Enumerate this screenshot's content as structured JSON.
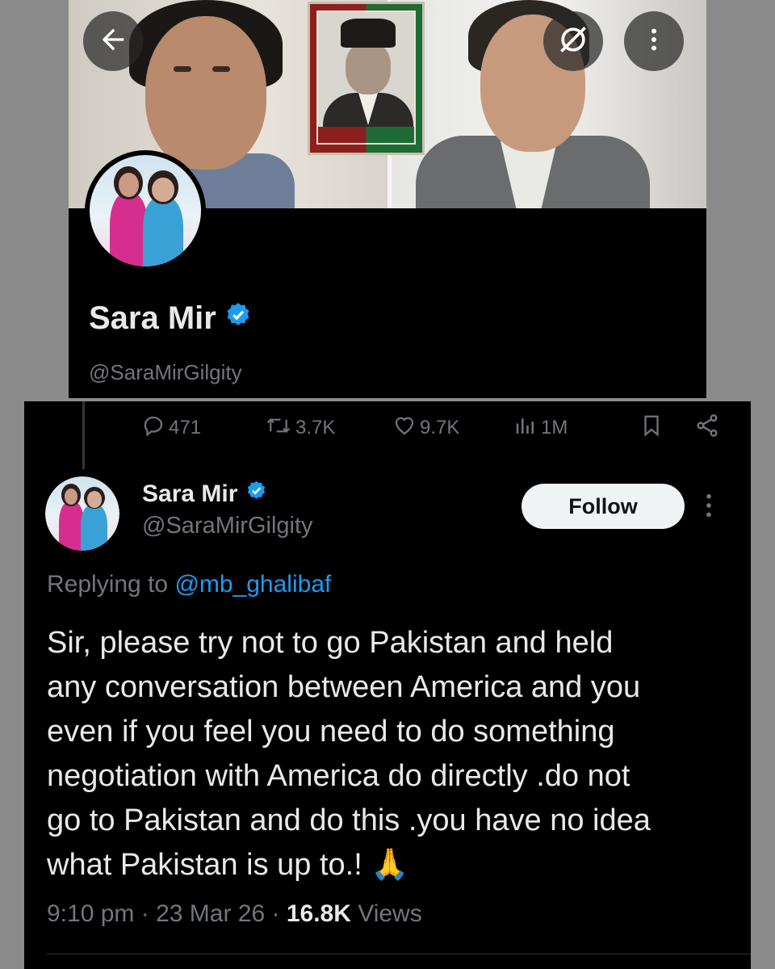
{
  "profile": {
    "name": "Sara Mir",
    "handle": "@SaraMirGilgity",
    "verified": true,
    "verified_color": "#1d9bf0"
  },
  "banner_buttons": {
    "back_icon": "arrow-left-icon",
    "fullscreen_icon": "expand-off-icon",
    "more_icon": "more-vertical-icon"
  },
  "tweet": {
    "author_name": "Sara Mir",
    "author_handle": "@SaraMirGilgity",
    "follow_label": "Follow",
    "replying_prefix": "Replying to ",
    "replying_mention": "@mb_ghalibaf",
    "text": "Sir, please try not to go Pakistan and held\nany conversation between America and you\neven if you feel you need to do something\nnegotiation with America do directly .do not\ngo to Pakistan and do this .you have no idea\nwhat Pakistan is up to.! 🙏",
    "time": "9:10 pm",
    "date": "23 Mar 26",
    "views_count": "16.8K",
    "views_label": "Views",
    "separator": " · "
  },
  "actions": {
    "replies": "471",
    "retweets": "3.7K",
    "likes": "9.7K",
    "views": "1M"
  },
  "colors": {
    "background": "#000000",
    "text": "#e7e9ea",
    "muted": "#71767b",
    "link": "#1d9bf0",
    "follow_bg": "#eff3f4"
  }
}
